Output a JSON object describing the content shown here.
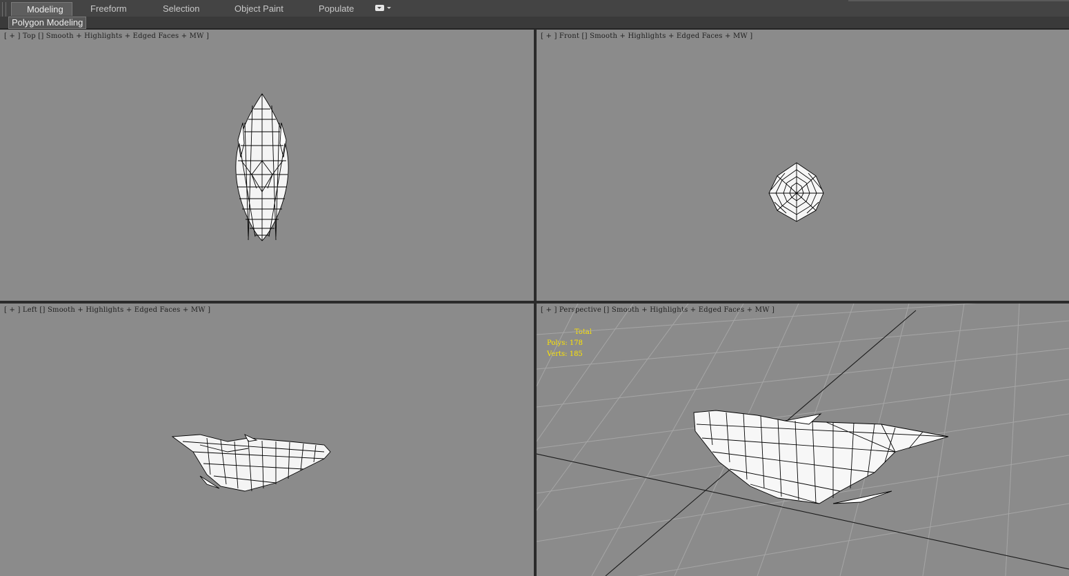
{
  "ribbon": {
    "tabs": [
      {
        "label": "Modeling",
        "active": true
      },
      {
        "label": "Freeform",
        "active": false
      },
      {
        "label": "Selection",
        "active": false
      },
      {
        "label": "Object Paint",
        "active": false
      },
      {
        "label": "Populate",
        "active": false
      }
    ]
  },
  "subribbon": {
    "panel_label": "Polygon Modeling"
  },
  "viewports": {
    "top": {
      "label": "[ + ] Top [] Smooth + Highlights + Edged Faces + MW ]"
    },
    "front": {
      "label": "[ + ] Front [] Smooth + Highlights + Edged Faces + MW ]"
    },
    "left": {
      "label": "[ + ] Left [] Smooth + Highlights + Edged Faces + MW ]"
    },
    "perspective": {
      "label": "[ + ] Perspective [] Smooth + Highlights + Edged Faces + MW ]",
      "stats": {
        "title": "Total",
        "polys": "Polys: 178",
        "verts": "Verts: 185"
      }
    }
  },
  "colors": {
    "viewport_bg": "#8b8b8b",
    "ribbon_bg": "#444444",
    "stats_text": "#ffe600",
    "mesh_fill": "#ffffff",
    "wire": "#000000"
  }
}
